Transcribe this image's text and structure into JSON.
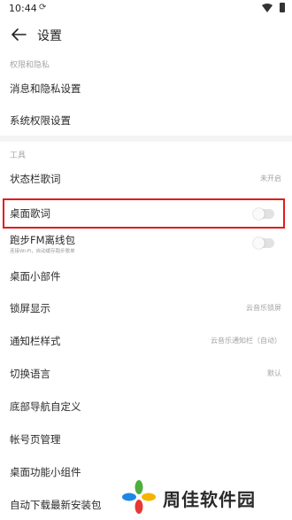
{
  "status_bar": {
    "time": "10:44",
    "sync_icon": "sync-icon"
  },
  "header": {
    "title": "设置",
    "back_icon": "arrow-left-icon"
  },
  "sections": [
    {
      "label": "权限和隐私",
      "items": [
        {
          "label": "消息和隐私设置"
        },
        {
          "label": "系统权限设置"
        }
      ]
    },
    {
      "label": "工具",
      "items": [
        {
          "label": "状态栏歌词",
          "value": "未开启"
        },
        {
          "label": "桌面歌词",
          "toggle": false,
          "highlighted": true
        },
        {
          "label": "跑步FM离线包",
          "sub": "连接Wi-Fi，自动缓存跑步歌单",
          "toggle": false
        },
        {
          "label": "桌面小部件"
        },
        {
          "label": "锁屏显示",
          "value": "云音乐锁屏"
        },
        {
          "label": "通知栏样式",
          "value": "云音乐通知栏（自动）"
        },
        {
          "label": "切换语言",
          "value": "默认"
        },
        {
          "label": "底部导航自定义"
        },
        {
          "label": "帐号页管理"
        },
        {
          "label": "桌面功能小组件"
        },
        {
          "label": "自动下载最新安装包"
        }
      ]
    }
  ],
  "watermark": {
    "text": "周佳软件园"
  },
  "colors": {
    "highlight_border": "#e41b1b",
    "toggle_off_track": "#e2e2e2",
    "section_label": "#a6a6a6",
    "value_text": "#a3a3a3"
  }
}
